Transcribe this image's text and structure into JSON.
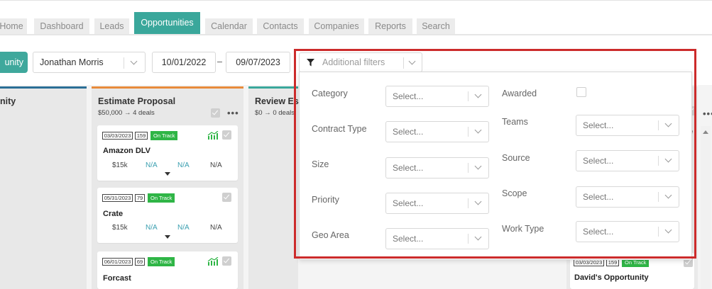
{
  "nav": {
    "tabs": [
      {
        "label": "Home"
      },
      {
        "label": "Dashboard"
      },
      {
        "label": "Leads"
      },
      {
        "label": "Opportunities"
      },
      {
        "label": "Calendar"
      },
      {
        "label": "Contacts"
      },
      {
        "label": "Companies"
      },
      {
        "label": "Reports"
      },
      {
        "label": "Search"
      }
    ],
    "active": "Opportunities"
  },
  "toolbar": {
    "add_button_label": "unity",
    "user": "Jonathan Morris",
    "date_from": "10/01/2022",
    "date_separator": "–",
    "date_to": "09/07/2023",
    "additional_filters_placeholder": "Additional filters"
  },
  "board": {
    "columns": [
      {
        "title": "nity",
        "accent": "#2b6f96"
      },
      {
        "title": "Estimate Proposal",
        "summary": "$50,000 → 4 deals",
        "accent": "#e88b3c"
      },
      {
        "title": "Review Est",
        "summary": "$0 → 0 deals",
        "accent": "#3aa79b"
      }
    ],
    "cards": [
      {
        "date": "03/03/2023",
        "days": "159",
        "status": "On Track",
        "name": "Amazon DLV",
        "amount": "$15k",
        "m1": "N/A",
        "m2": "N/A",
        "m3": "N/A"
      },
      {
        "date": "05/31/2023",
        "days": "79",
        "status": "On Track",
        "name": "Crate",
        "amount": "$15k",
        "m1": "N/A",
        "m2": "N/A",
        "m3": "N/A"
      },
      {
        "date": "06/01/2023",
        "days": "69",
        "status": "On Track",
        "name": "Forcast"
      }
    ],
    "right_card": {
      "date": "03/03/2023",
      "days": "159",
      "status": "On Track",
      "name": "David's Opportunity",
      "partial_letter": "e"
    },
    "menu_dots": "•••"
  },
  "filters": {
    "left": [
      {
        "label": "Category",
        "placeholder": "Select..."
      },
      {
        "label": "Contract Type",
        "placeholder": "Select..."
      },
      {
        "label": "Size",
        "placeholder": "Select..."
      },
      {
        "label": "Priority",
        "placeholder": "Select..."
      },
      {
        "label": "Geo Area",
        "placeholder": "Select..."
      }
    ],
    "awarded_label": "Awarded",
    "right": [
      {
        "label": "Teams",
        "placeholder": "Select..."
      },
      {
        "label": "Source",
        "placeholder": "Select..."
      },
      {
        "label": "Scope",
        "placeholder": "Select..."
      },
      {
        "label": "Work Type",
        "placeholder": "Select..."
      }
    ]
  },
  "colors": {
    "brand_teal": "#3aa79b",
    "status_green": "#2fb546",
    "highlight_red": "#cc2b2b"
  },
  "icons": {
    "filter": "funnel-icon",
    "dropdown": "chevron-down-icon",
    "trend": "trend-chart-icon",
    "check": "checkbox-icon"
  }
}
